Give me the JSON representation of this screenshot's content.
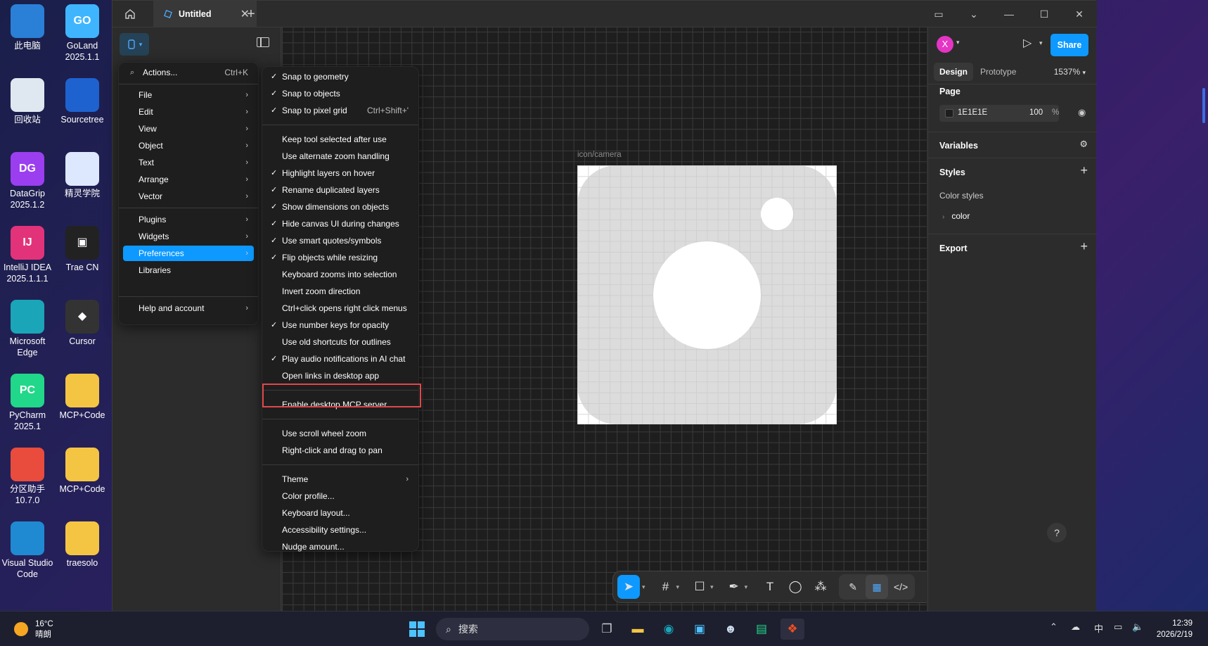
{
  "desktop": {
    "icons": [
      {
        "label": "此电脑",
        "icon": "computer-icon",
        "color": "#2a7fd6"
      },
      {
        "label": "GoLand 2025.1.1",
        "icon": "goland-icon",
        "color": "#3fb5ff",
        "glyph": "GO"
      },
      {
        "label": "回收站",
        "icon": "recycle-bin-icon",
        "color": "#dfe8f0"
      },
      {
        "label": "Sourcetree",
        "icon": "sourcetree-icon",
        "color": "#1e62d0"
      },
      {
        "label": "DataGrip 2025.1.2",
        "icon": "datagrip-icon",
        "color": "#9b3ef0",
        "glyph": "DG"
      },
      {
        "label": "精灵学院",
        "icon": "mascot-icon",
        "color": "#dde8ff"
      },
      {
        "label": "IntelliJ IDEA 2025.1.1.1",
        "icon": "intellij-icon",
        "color": "#e2337a",
        "glyph": "IJ"
      },
      {
        "label": "Trae CN",
        "icon": "trae-icon",
        "color": "#222",
        "glyph": "▣"
      },
      {
        "label": "Microsoft Edge",
        "icon": "edge-icon",
        "color": "#1aa5b8"
      },
      {
        "label": "Cursor",
        "icon": "cursor-app-icon",
        "color": "#333",
        "glyph": "◆"
      },
      {
        "label": "PyCharm 2025.1",
        "icon": "pycharm-icon",
        "color": "#21d789",
        "glyph": "PC"
      },
      {
        "label": "MCP+Code",
        "icon": "zip-folder-icon",
        "color": "#f4c542"
      },
      {
        "label": "分区助手 10.7.0",
        "icon": "partition-icon",
        "color": "#e94b3c"
      },
      {
        "label": "MCP+Code",
        "icon": "folder-icon",
        "color": "#f4c542"
      },
      {
        "label": "Visual Studio Code",
        "icon": "vscode-icon",
        "color": "#1f8ad2"
      },
      {
        "label": "traesolo",
        "icon": "folder-icon",
        "color": "#f4c542"
      }
    ]
  },
  "titlebar": {
    "tab_title": "Untitled",
    "close_glyph": "✕",
    "plus_glyph": "+"
  },
  "main_menu": {
    "search_label": "Actions...",
    "search_shortcut": "Ctrl+K",
    "items": [
      "File",
      "Edit",
      "View",
      "Object",
      "Text",
      "Arrange",
      "Vector"
    ],
    "items2": [
      "Plugins",
      "Widgets",
      "Preferences",
      "Libraries"
    ],
    "items2_submenu": [
      true,
      true,
      true,
      false
    ],
    "highlighted": "Preferences",
    "help": "Help and account"
  },
  "preferences": {
    "group1": [
      {
        "label": "Snap to geometry",
        "checked": true
      },
      {
        "label": "Snap to objects",
        "checked": true
      },
      {
        "label": "Snap to pixel grid",
        "checked": true,
        "shortcut": "Ctrl+Shift+'"
      }
    ],
    "group2": [
      {
        "label": "Keep tool selected after use",
        "checked": false
      },
      {
        "label": "Use alternate zoom handling",
        "checked": false
      },
      {
        "label": "Highlight layers on hover",
        "checked": true
      },
      {
        "label": "Rename duplicated layers",
        "checked": true
      },
      {
        "label": "Show dimensions on objects",
        "checked": true
      },
      {
        "label": "Hide canvas UI during changes",
        "checked": true
      },
      {
        "label": "Use smart quotes/symbols",
        "checked": true
      },
      {
        "label": "Flip objects while resizing",
        "checked": true
      },
      {
        "label": "Keyboard zooms into selection",
        "checked": false
      },
      {
        "label": "Invert zoom direction",
        "checked": false
      },
      {
        "label": "Ctrl+click opens right click menus",
        "checked": false
      },
      {
        "label": "Use number keys for opacity",
        "checked": true
      },
      {
        "label": "Use old shortcuts for outlines",
        "checked": false
      },
      {
        "label": "Play audio notifications in AI chat",
        "checked": true
      },
      {
        "label": "Open links in desktop app",
        "checked": false
      }
    ],
    "group3": [
      {
        "label": "Enable desktop MCP server",
        "checked": false
      }
    ],
    "group4": [
      {
        "label": "Use scroll wheel zoom",
        "checked": false
      },
      {
        "label": "Right-click and drag to pan",
        "checked": false
      }
    ],
    "group5": [
      {
        "label": "Theme",
        "submenu": true
      },
      {
        "label": "Color profile...",
        "submenu": false
      },
      {
        "label": "Keyboard layout...",
        "submenu": false
      },
      {
        "label": "Accessibility settings...",
        "submenu": false
      },
      {
        "label": "Nudge amount...",
        "submenu": false
      }
    ]
  },
  "canvas": {
    "frame_label": "icon/camera"
  },
  "right_panel": {
    "avatar_letter": "X",
    "avatar_color": "#e535c4",
    "share_label": "Share",
    "tabs": [
      "Design",
      "Prototype"
    ],
    "zoom": "1537%",
    "page_title": "Page",
    "page_color_hex": "1E1E1E",
    "page_opacity": "100",
    "page_opacity_unit": "%",
    "variables_title": "Variables",
    "styles_title": "Styles",
    "color_styles_label": "Color styles",
    "color_group": "color",
    "export_title": "Export",
    "help_glyph": "?"
  },
  "taskbar": {
    "temperature": "16°C",
    "weather": "晴朗",
    "search_placeholder": "搜索",
    "time": "12:39",
    "date": "2026/2/19",
    "ime": "中"
  },
  "colors": {
    "accent": "#0d99ff",
    "highlight_box": "#e0474c",
    "canvas_bg": "#1e1e1e"
  }
}
